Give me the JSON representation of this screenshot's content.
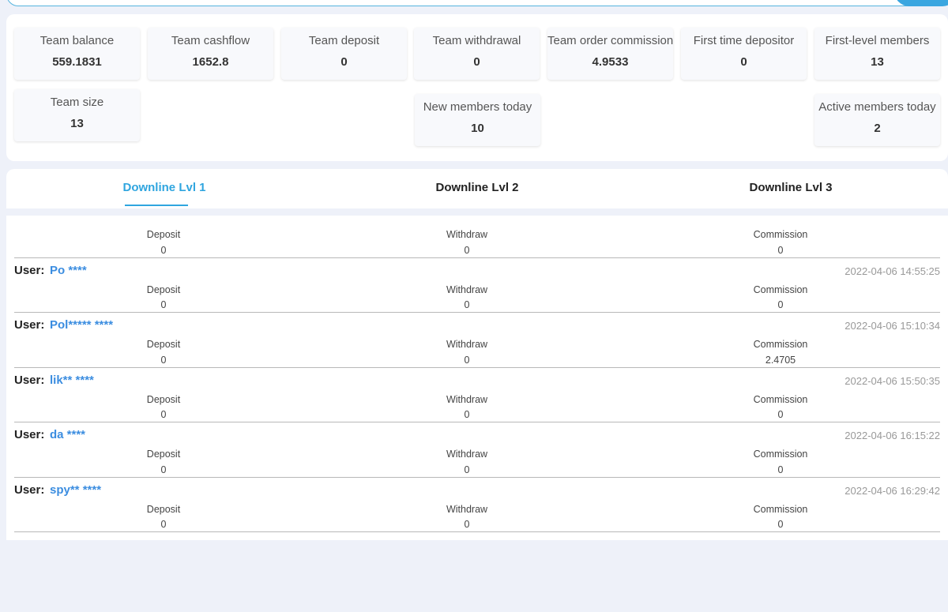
{
  "stats": [
    {
      "label": "Team balance",
      "value": "559.1831"
    },
    {
      "label": "Team cashflow",
      "value": "1652.8"
    },
    {
      "label": "Team deposit",
      "value": "0"
    },
    {
      "label": "Team withdrawal",
      "value": "0"
    },
    {
      "label": "Team order commission",
      "value": "4.9533"
    },
    {
      "label": "First time depositor",
      "value": "0"
    },
    {
      "label": "First-level members",
      "value": "13"
    },
    {
      "label": "Team size",
      "value": "13"
    },
    {
      "label": "New members today",
      "value": "10"
    },
    {
      "label": "Active members today",
      "value": "2"
    }
  ],
  "tabs": [
    {
      "label": "Downline Lvl 1",
      "active": true
    },
    {
      "label": "Downline Lvl 2",
      "active": false
    },
    {
      "label": "Downline Lvl 3",
      "active": false
    }
  ],
  "columns": {
    "deposit": "Deposit",
    "withdraw": "Withdraw",
    "commission": "Commission"
  },
  "user_prefix": "User:",
  "summary": {
    "deposit": "0",
    "withdraw": "0",
    "commission": "0"
  },
  "users": [
    {
      "name": "Po ****",
      "time": "2022-04-06 14:55:25",
      "deposit": "0",
      "withdraw": "0",
      "commission": "0"
    },
    {
      "name": "Pol***** ****",
      "time": "2022-04-06 15:10:34",
      "deposit": "0",
      "withdraw": "0",
      "commission": "2.4705"
    },
    {
      "name": "lik** ****",
      "time": "2022-04-06 15:50:35",
      "deposit": "0",
      "withdraw": "0",
      "commission": "0"
    },
    {
      "name": "da ****",
      "time": "2022-04-06 16:15:22",
      "deposit": "0",
      "withdraw": "0",
      "commission": "0"
    },
    {
      "name": "spy** ****",
      "time": "2022-04-06 16:29:42",
      "deposit": "0",
      "withdraw": "0",
      "commission": "0"
    }
  ]
}
